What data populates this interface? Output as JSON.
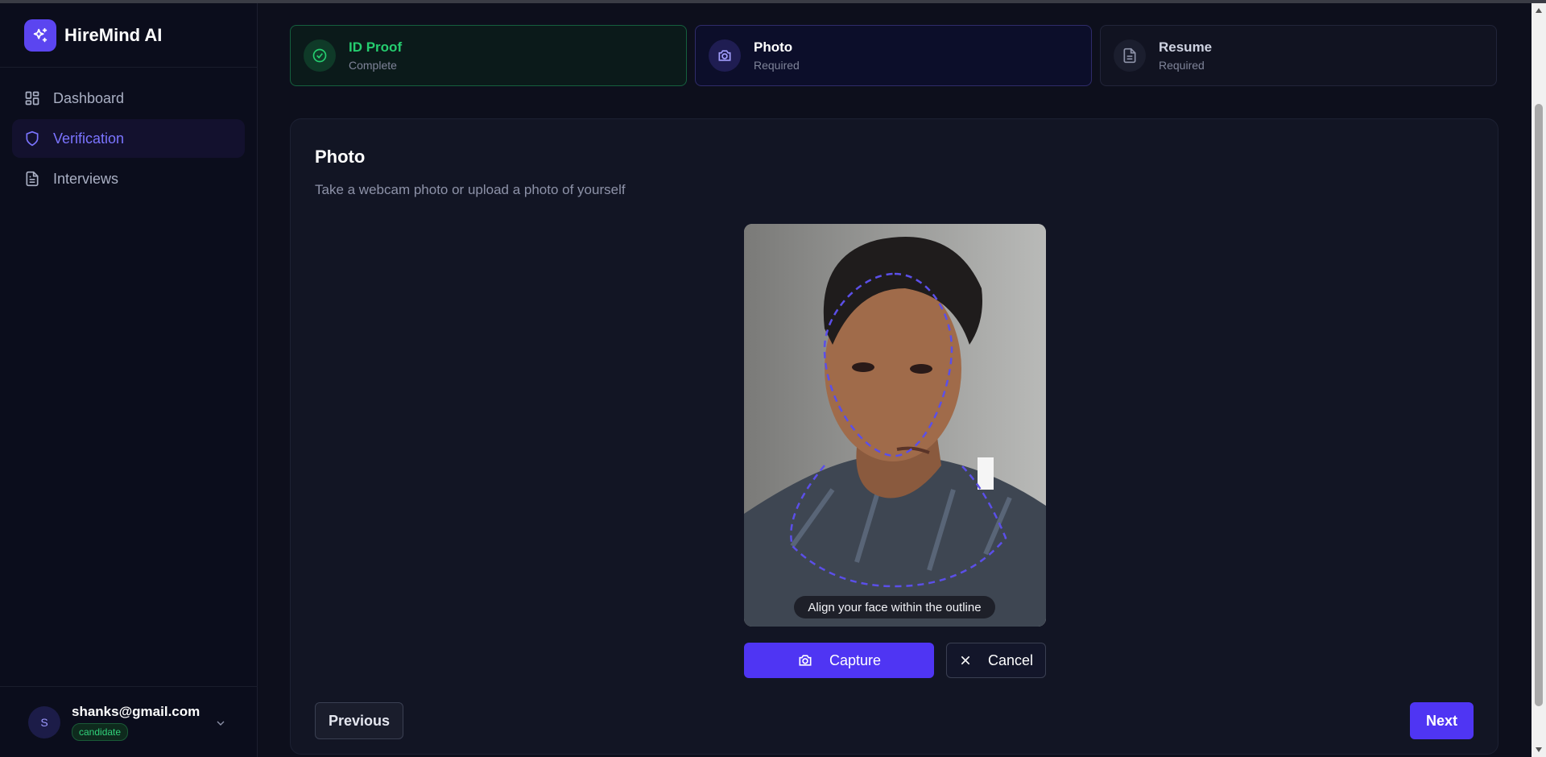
{
  "app": {
    "name": "HireMind AI",
    "logo_icon": "sparkles-icon"
  },
  "sidebar": {
    "items": [
      {
        "label": "Dashboard",
        "icon": "grid-icon",
        "active": false
      },
      {
        "label": "Verification",
        "icon": "shield-icon",
        "active": true
      },
      {
        "label": "Interviews",
        "icon": "document-icon",
        "active": false
      }
    ]
  },
  "user": {
    "initial": "S",
    "email": "shanks@gmail.com",
    "role": "candidate"
  },
  "steps": [
    {
      "title": "ID Proof",
      "status": "Complete",
      "icon": "check-circle-icon"
    },
    {
      "title": "Photo",
      "status": "Required",
      "icon": "camera-icon"
    },
    {
      "title": "Resume",
      "status": "Required",
      "icon": "file-icon"
    }
  ],
  "card": {
    "title": "Photo",
    "subtitle": "Take a webcam photo or upload a photo of yourself",
    "camera_hint": "Align your face within the outline",
    "capture_label": "Capture",
    "cancel_label": "Cancel"
  },
  "footer": {
    "previous_label": "Previous",
    "next_label": "Next"
  },
  "colors": {
    "accent": "#4f35f3",
    "success": "#25cd6f",
    "background": "#0d0f1c"
  }
}
